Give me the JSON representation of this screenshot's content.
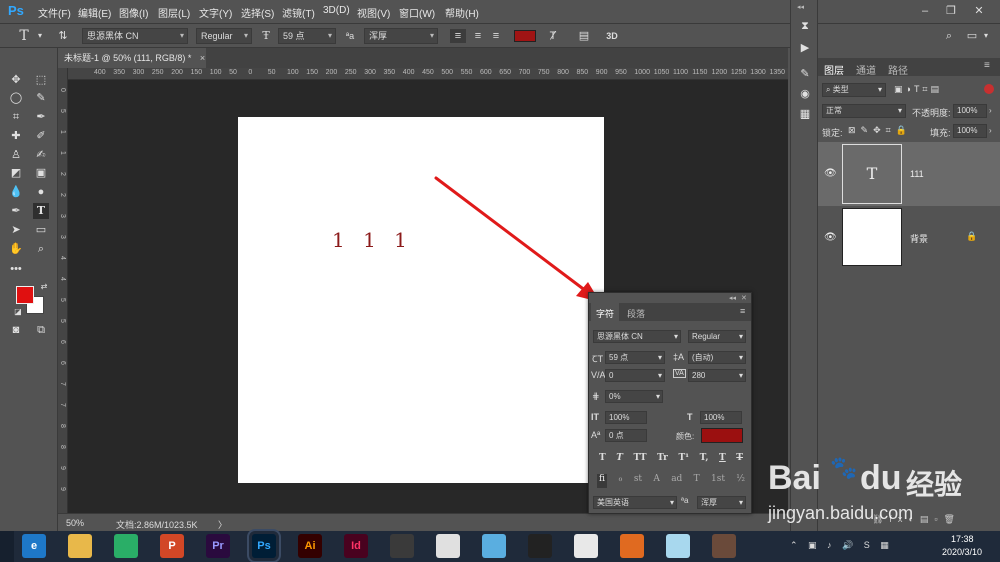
{
  "app": {
    "logo": "Ps"
  },
  "menu": [
    "文件(F)",
    "编辑(E)",
    "图像(I)",
    "图层(L)",
    "文字(Y)",
    "选择(S)",
    "滤镜(T)",
    "3D(D)",
    "视图(V)",
    "窗口(W)",
    "帮助(H)"
  ],
  "options": {
    "tool_letter": "T",
    "font_family": "思源黑体 CN",
    "font_style": "Regular",
    "font_size": "59 点",
    "aa_mode": "浑厚",
    "threeD": "3D",
    "color": "#a01414"
  },
  "document": {
    "tab_title": "未标题-1 @ 50% (111, RGB/8) *",
    "canvas_text": "1 1 1",
    "text_color": "#8b1a1a"
  },
  "rulers": {
    "top": [
      "400",
      "350",
      "300",
      "250",
      "200",
      "150",
      "100",
      "50",
      "0",
      "50",
      "100",
      "150",
      "200",
      "250",
      "300",
      "350",
      "400",
      "450",
      "500",
      "550",
      "600",
      "650",
      "700",
      "750",
      "800",
      "850",
      "900",
      "950",
      "1000",
      "1050",
      "1100",
      "1150",
      "1200",
      "1250",
      "1300",
      "1350",
      "1400"
    ],
    "left": [
      "0",
      "5",
      "1",
      "1",
      "2",
      "2",
      "3",
      "3",
      "4",
      "4",
      "5",
      "5",
      "6",
      "6",
      "7",
      "7",
      "8",
      "8",
      "9",
      "9"
    ]
  },
  "status": {
    "zoom": "50%",
    "doc_info": "文档:2.86M/1023.5K",
    "arrow": "〉"
  },
  "layers_panel": {
    "tabs": [
      "图层",
      "通道",
      "路径"
    ],
    "kind_filter": "类型",
    "blend_mode": "正常",
    "opacity_label": "不透明度:",
    "opacity_value": "100%",
    "lock_label": "锁定:",
    "fill_label": "填充:",
    "fill_value": "100%",
    "layers": [
      {
        "name": "111",
        "thumb": "T"
      },
      {
        "name": "背景",
        "thumb": ""
      }
    ]
  },
  "character_panel": {
    "tabs": [
      "字符",
      "段落"
    ],
    "font_family": "思源黑体 CN",
    "font_style": "Regular",
    "size": "59 点",
    "leading": "(自动)",
    "kerning": "0",
    "tracking": "280",
    "scale_pct": "0%",
    "vscale": "100%",
    "hscale": "100%",
    "baseline": "0 点",
    "color_label": "颜色:",
    "color": "#9b1010",
    "style_buttons": [
      "T",
      "T",
      "TT",
      "Tr",
      "T¹",
      "T,",
      "T",
      "T"
    ],
    "ot_buttons": [
      "fi",
      "ℴ",
      "st",
      "A",
      "ad",
      "T",
      "1st",
      "½"
    ],
    "language": "美国英语",
    "aa_label": "ªa",
    "aa_mode": "浑厚"
  },
  "taskbar": {
    "apps": [
      {
        "name": "ie",
        "label": "e",
        "color": "#1e78c8"
      },
      {
        "name": "explorer",
        "label": "",
        "color": "#e8b84a"
      },
      {
        "name": "wechat",
        "label": "",
        "color": "#2aae67"
      },
      {
        "name": "powerpoint",
        "label": "P",
        "color": "#d24726"
      },
      {
        "name": "premiere",
        "label": "Pr",
        "color": "#2a0a3e"
      },
      {
        "name": "photoshop",
        "label": "Ps",
        "color": "#001e36"
      },
      {
        "name": "illustrator",
        "label": "Ai",
        "color": "#330000"
      },
      {
        "name": "indesign",
        "label": "Id",
        "color": "#49021f"
      },
      {
        "name": "video",
        "label": "",
        "color": "#3a3a3a"
      },
      {
        "name": "app-green",
        "label": "",
        "color": "#e0e0e0"
      },
      {
        "name": "app-blue",
        "label": "",
        "color": "#5aaee0"
      },
      {
        "name": "qq",
        "label": "",
        "color": "#222"
      },
      {
        "name": "chrome",
        "label": "",
        "color": "#e8e8e8"
      },
      {
        "name": "app-orange",
        "label": "",
        "color": "#e06a20"
      },
      {
        "name": "app-lightblue",
        "label": "",
        "color": "#a8d8ee"
      },
      {
        "name": "avatar",
        "label": "",
        "color": "#6a4a3a"
      }
    ],
    "time": "17:38",
    "date": "2020/3/10"
  },
  "watermark": {
    "brand": "Bai",
    "paw": "du",
    "jingyan": "经验",
    "url": "jingyan.baidu.com"
  }
}
